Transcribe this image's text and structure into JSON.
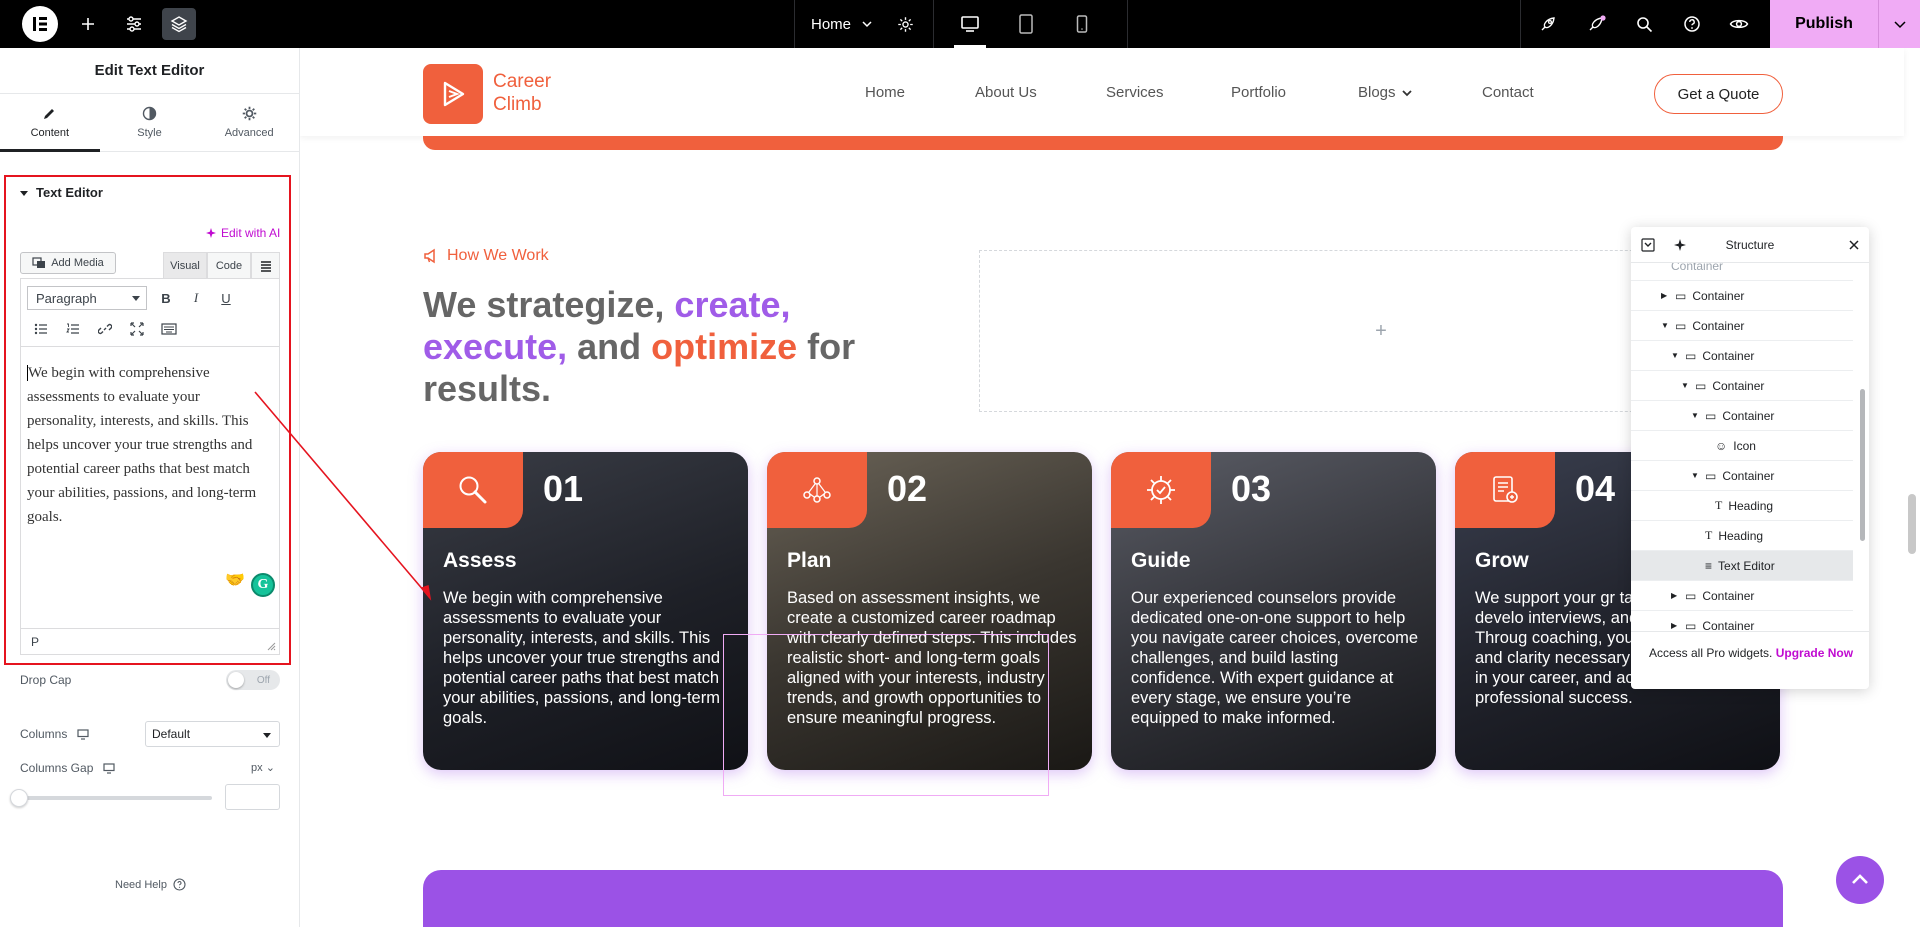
{
  "topbar": {
    "page_name": "Home",
    "publish_label": "Publish"
  },
  "panel": {
    "title": "Edit Text Editor",
    "tabs": [
      {
        "label": "Content"
      },
      {
        "label": "Style"
      },
      {
        "label": "Advanced"
      }
    ],
    "section_title": "Text Editor",
    "edit_ai_label": "Edit with AI",
    "add_media_label": "Add Media",
    "visual_tab": "Visual",
    "code_tab": "Code",
    "paragraph_format": "Paragraph",
    "editor_text": "We begin with comprehensive assessments to evaluate your personality, interests, and skills. This helps uncover your true strengths and potential career paths that best match your abilities, passions, and long-term goals.",
    "editor_path": "P",
    "drop_cap_label": "Drop Cap",
    "drop_cap_state": "Off",
    "columns_label": "Columns",
    "columns_value": "Default",
    "columns_gap_label": "Columns Gap",
    "columns_gap_unit": "px",
    "need_help": "Need Help"
  },
  "site": {
    "brand_line1": "Career",
    "brand_line2": "Climb",
    "nav": [
      "Home",
      "About Us",
      "Services",
      "Portfolio",
      "Blogs",
      "Contact"
    ],
    "quote_button": "Get a Quote",
    "section_tag": "How We Work",
    "heading": {
      "p1": "We strategize, ",
      "p2": "create,",
      "p3": "execute,",
      "p4": " and ",
      "p5": "optimize",
      "p6": " for results."
    },
    "empty_plus": "+",
    "cards": [
      {
        "num": "01",
        "title": "Assess",
        "desc": "We begin with comprehensive assessments to evaluate your personality, interests, and skills. This helps uncover your true strengths and potential career paths that best match your abilities, passions, and long-term goals."
      },
      {
        "num": "02",
        "title": "Plan",
        "desc": "Based on assessment insights, we create a customized career roadmap with clearly defined steps. This includes realistic short- and long-term goals aligned with your interests, industry trends, and growth opportunities to ensure meaningful progress."
      },
      {
        "num": "03",
        "title": "Guide",
        "desc": "Our experienced counselors provide dedicated one-on-one support to help you navigate career choices, overcome challenges, and build lasting confidence. With expert guidance at every stage, we ensure you’re equipped to make informed."
      },
      {
        "num": "04",
        "title": "Grow",
        "desc": "We support your gr targeted skill develo interviews, and stra preparation. Throug coaching, you’ll acq confidence, and clarity necessary to excel, advance in your career, and achieve professional success."
      }
    ]
  },
  "structure": {
    "title": "Structure",
    "partial_top": "Container",
    "rows": [
      {
        "label": "Container",
        "arrow": "▶"
      },
      {
        "label": "Container",
        "arrow": "▼"
      },
      {
        "label": "Container",
        "arrow": "▼"
      },
      {
        "label": "Container",
        "arrow": "▼"
      },
      {
        "label": "Container",
        "arrow": "▼"
      },
      {
        "label": "Icon",
        "arrow": ""
      },
      {
        "label": "Container",
        "arrow": "▼"
      },
      {
        "label": "Heading",
        "arrow": ""
      },
      {
        "label": "Heading",
        "arrow": ""
      },
      {
        "label": "Text Editor",
        "arrow": ""
      },
      {
        "label": "Container",
        "arrow": "▶"
      },
      {
        "label": "Container",
        "arrow": "▶"
      }
    ],
    "footer_text": "Access all Pro widgets.",
    "footer_link": "Upgrade Now"
  },
  "colors": {
    "brand_orange": "#f0603d",
    "accent_purple": "#a05ce8",
    "publish_pink": "#f0abf5",
    "annotation_red": "#e5141f"
  }
}
